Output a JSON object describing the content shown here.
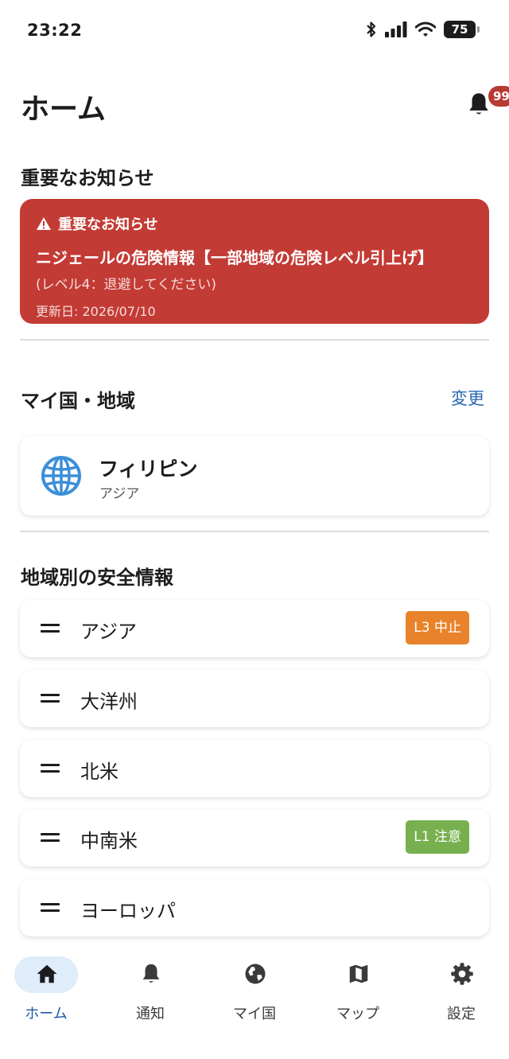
{
  "status_bar": {
    "time": "23:22",
    "battery": "75"
  },
  "header": {
    "title": "ホーム",
    "notification_badge": "99"
  },
  "important": {
    "section_title": "重要なお知らせ",
    "card_label": "重要なお知らせ",
    "title": "ニジェールの危険情報【一部地域の危険レベル引上げ】",
    "subtitle": "(レベル4：退避してください)",
    "updated": "更新日: 2026/07/10",
    "color": "#c33b35"
  },
  "my_country": {
    "section_title": "マイ国・地域",
    "change_label": "変更",
    "country": "フィリピン",
    "region": "アジア",
    "icon": "globe-icon"
  },
  "regions": {
    "section_title": "地域別の安全情報",
    "items": [
      {
        "label": "アジア",
        "badge": "L3 中止",
        "badge_color": "#e8832b"
      },
      {
        "label": "大洋州"
      },
      {
        "label": "北米"
      },
      {
        "label": "中南米",
        "badge": "L1 注意",
        "badge_color": "#78b04f"
      },
      {
        "label": "ヨーロッパ"
      }
    ]
  },
  "nav": {
    "active_color": "#1d5aa8",
    "items": [
      {
        "label": "ホーム",
        "icon": "home-icon",
        "active": true
      },
      {
        "label": "通知",
        "icon": "bell-icon"
      },
      {
        "label": "マイ国",
        "icon": "globe-icon"
      },
      {
        "label": "マップ",
        "icon": "map-icon"
      },
      {
        "label": "設定",
        "icon": "gear-icon"
      }
    ]
  }
}
